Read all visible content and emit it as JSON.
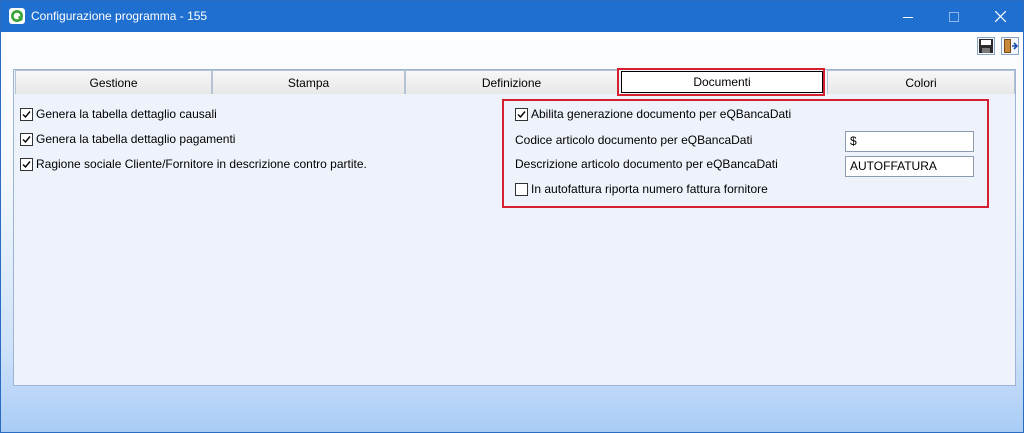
{
  "window": {
    "title": "Configurazione programma - 155",
    "minimize_icon": "minimize-icon",
    "maximize_icon": "maximize-icon",
    "close_icon": "close-icon"
  },
  "toolbar": {
    "save_icon": "save-icon",
    "exit_icon": "exit-icon"
  },
  "tabs": [
    {
      "label": "Gestione"
    },
    {
      "label": "Stampa"
    },
    {
      "label": "Definizione"
    },
    {
      "label": "Documenti",
      "active": true
    },
    {
      "label": "Colori"
    }
  ],
  "left": {
    "options": [
      {
        "label": "Genera la tabella dettaglio causali",
        "checked": true
      },
      {
        "label": "Genera la tabella dettaglio pagamenti",
        "checked": true
      },
      {
        "label": "Ragione sociale Cliente/Fornitore in descrizione contro partite.",
        "checked": true
      }
    ]
  },
  "right": {
    "enable_label": "Abilita generazione documento per eQBancaDati",
    "enable_checked": true,
    "code_label": "Codice articolo documento per eQBancaDati",
    "code_value": "$",
    "desc_label": "Descrizione articolo documento per eQBancaDati",
    "desc_value": "AUTOFFATURA",
    "autofattura_label": "In autofattura riporta numero fattura fornitore",
    "autofattura_checked": false
  },
  "colors": {
    "titlebar": "#1f6fd0",
    "highlight": "#d62030"
  }
}
